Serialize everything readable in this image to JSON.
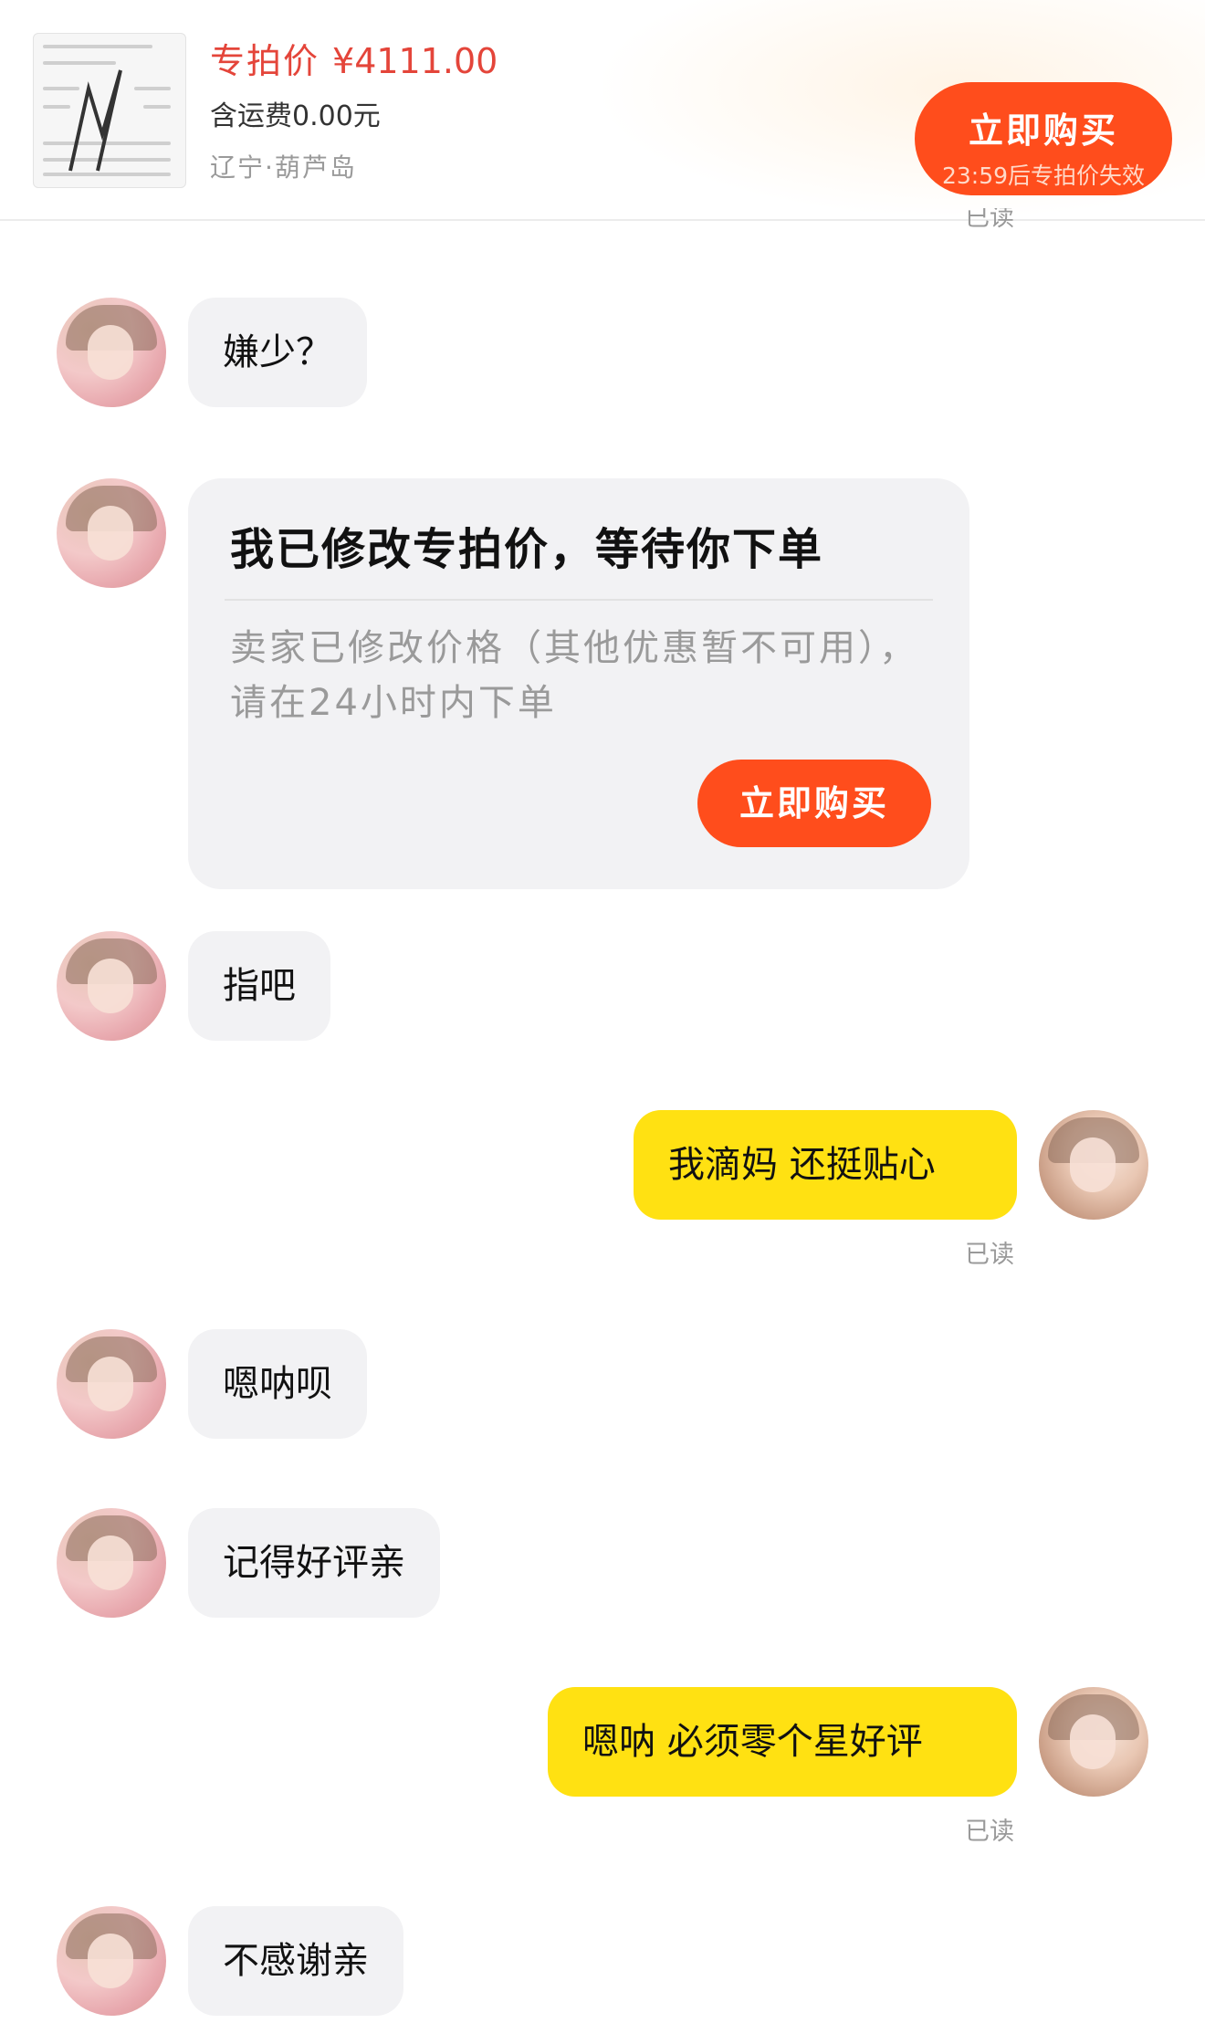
{
  "product": {
    "price_label": "专拍价",
    "price": "¥4111.00",
    "shipping": "含运费0.00元",
    "location": "辽宁·葫芦岛"
  },
  "buy_button": {
    "label": "立即购买",
    "countdown": "23:59后专拍价失效"
  },
  "status": {
    "read": "已读"
  },
  "messages": [
    {
      "text": "嫌少？"
    },
    {
      "text": "指吧"
    },
    {
      "text": "我滴妈 还挺贴心"
    },
    {
      "text": "嗯呐呗"
    },
    {
      "text": "记得好评亲"
    },
    {
      "text": "嗯呐 必须零个星好评"
    },
    {
      "text": "不感谢亲"
    }
  ],
  "price_card": {
    "title": "我已修改专拍价，等待你下单",
    "description": "卖家已修改价格（其他优惠暂不可用），请在24小时内下单",
    "button": "立即购买"
  },
  "colors": {
    "accent": "#ff4d1c",
    "price": "#e4453a",
    "my_bubble": "#ffe112",
    "other_bubble": "#f2f2f4"
  }
}
